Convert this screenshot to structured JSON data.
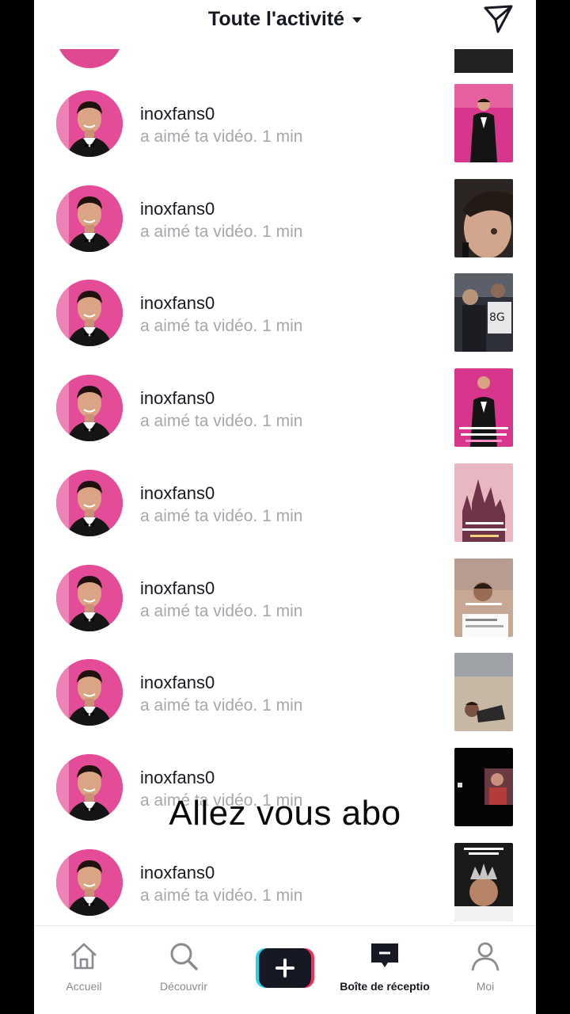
{
  "header": {
    "title": "Toute l'activité",
    "send_icon": "paper-plane-icon"
  },
  "notifications": [
    {
      "username": "inoxfans0",
      "action": "a aimé ta vidéo.",
      "time": "1 min",
      "thumb": "tuxedo-pink"
    },
    {
      "username": "inoxfans0",
      "action": "a aimé ta vidéo.",
      "time": "1 min",
      "thumb": "face-closeup"
    },
    {
      "username": "inoxfans0",
      "action": "a aimé ta vidéo.",
      "time": "1 min",
      "thumb": "crowd-dark"
    },
    {
      "username": "inoxfans0",
      "action": "a aimé ta vidéo.",
      "time": "1 min",
      "thumb": "tuxedo-pink-text"
    },
    {
      "username": "inoxfans0",
      "action": "a aimé ta vidéo.",
      "time": "1 min",
      "thumb": "castle-pink"
    },
    {
      "username": "inoxfans0",
      "action": "a aimé ta vidéo.",
      "time": "1 min",
      "thumb": "sand-portrait"
    },
    {
      "username": "inoxfans0",
      "action": "a aimé ta vidéo.",
      "time": "1 min",
      "thumb": "desert-lying"
    },
    {
      "username": "inoxfans0",
      "action": "a aimé ta vidéo.",
      "time": "1 min",
      "thumb": "black-frame"
    },
    {
      "username": "inoxfans0",
      "action": "a aimé ta vidéo.",
      "time": "1 min",
      "thumb": "crown-boy"
    }
  ],
  "caption": "Allez vous abo",
  "bottom_nav": {
    "home": "Accueil",
    "discover": "Découvrir",
    "inbox": "Boîte de réceptio",
    "profile": "Moi"
  },
  "colors": {
    "accent_pink": "#e54c98",
    "create_left": "#20d5ec",
    "create_right": "#fe2c55"
  }
}
